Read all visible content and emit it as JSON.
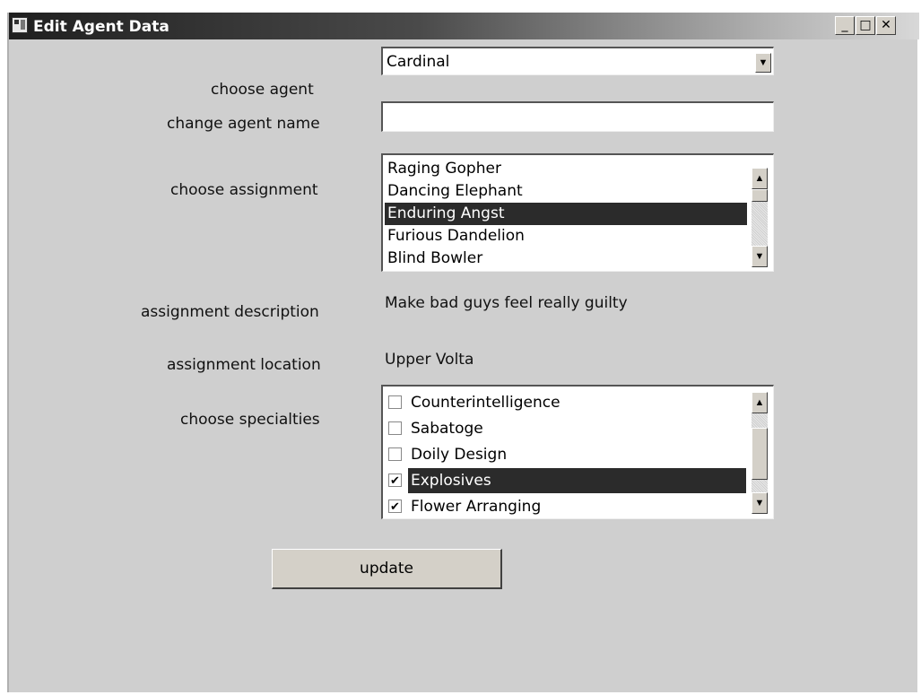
{
  "window": {
    "title": "Edit Agent Data",
    "controls": {
      "minimize": "_",
      "maximize": "□",
      "close": "✕"
    }
  },
  "form": {
    "choose_agent_label": "choose agent",
    "agent_selected": "Cardinal",
    "change_agent_name_label": "change agent name",
    "agent_name_value": "",
    "choose_assignment_label": "choose assignment",
    "assignments": [
      "Raging Gopher",
      "Dancing Elephant",
      "Enduring Angst",
      "Furious Dandelion",
      "Blind Bowler"
    ],
    "selected_assignment_index": 2,
    "assignment_description_label": "assignment description",
    "assignment_description_value": "Make bad guys feel really guilty",
    "assignment_location_label": "assignment location",
    "assignment_location_value": "Upper Volta",
    "choose_specialties_label": "choose specialties",
    "specialties": [
      {
        "label": "Counterintelligence",
        "checked": false
      },
      {
        "label": "Sabatoge",
        "checked": false
      },
      {
        "label": "Doily Design",
        "checked": false
      },
      {
        "label": "Explosives",
        "checked": true
      },
      {
        "label": "Flower Arranging",
        "checked": true
      }
    ],
    "selected_specialty_index": 3,
    "update_label": "update"
  }
}
